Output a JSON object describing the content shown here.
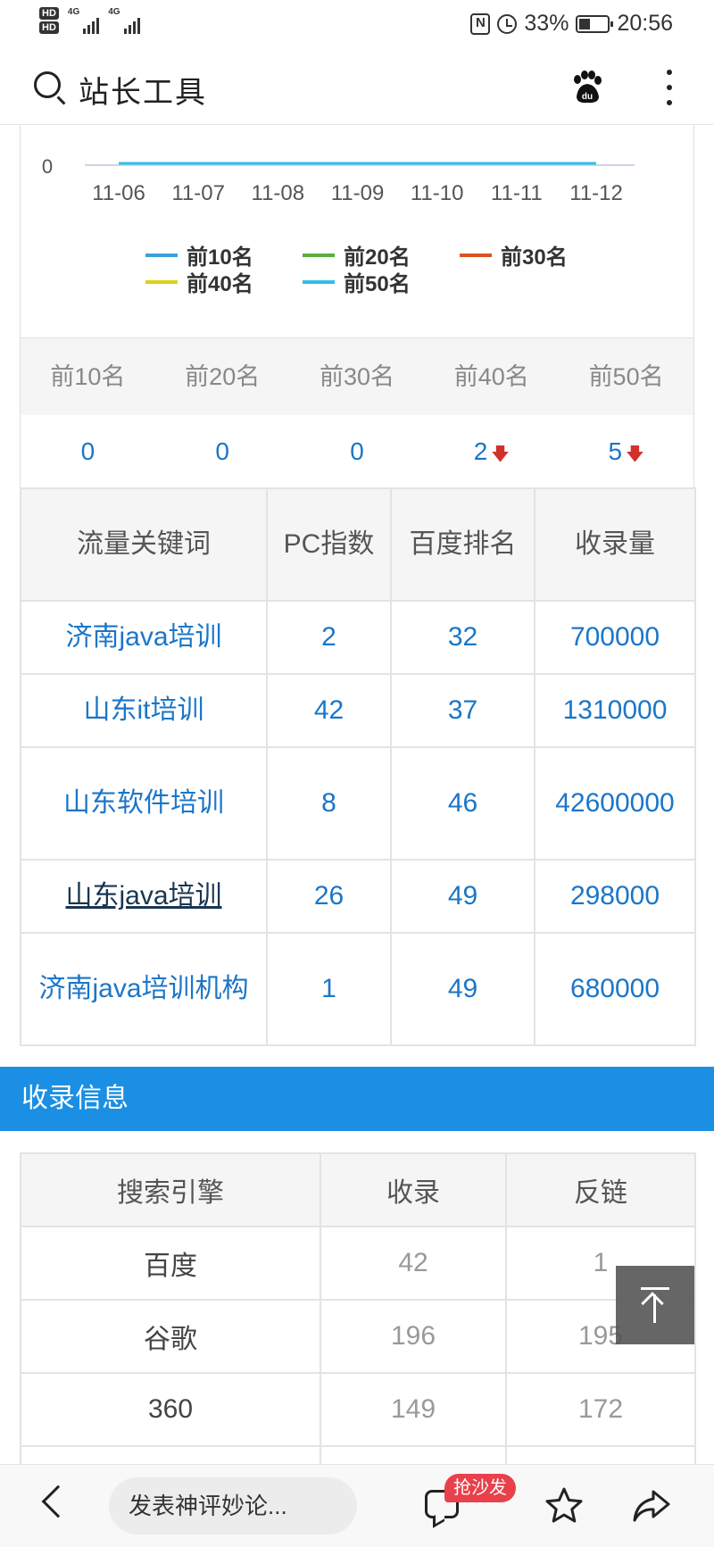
{
  "status_bar": {
    "hd1": "HD",
    "hd2": "HD",
    "net1": "4G",
    "net2": "4G",
    "nfc": "N",
    "battery": "33%",
    "time": "20:56"
  },
  "header": {
    "title": "站长工具",
    "icons": [
      "search-icon",
      "baidu-paw-icon",
      "more-icon"
    ]
  },
  "chart_data": {
    "type": "line",
    "x": [
      "11-06",
      "11-07",
      "11-08",
      "11-09",
      "11-10",
      "11-11",
      "11-12"
    ],
    "ytick": "0",
    "series": [
      {
        "name": "前10名",
        "color": "#3ba0d8",
        "values": [
          0,
          0,
          0,
          0,
          0,
          0,
          0
        ]
      },
      {
        "name": "前20名",
        "color": "#5cab3f",
        "values": [
          0,
          0,
          0,
          0,
          0,
          0,
          0
        ]
      },
      {
        "name": "前30名",
        "color": "#d9541e",
        "values": [
          0,
          0,
          0,
          0,
          0,
          0,
          0
        ]
      },
      {
        "name": "前40名",
        "color": "#e0d012",
        "values": [
          0,
          0,
          0,
          0,
          0,
          0,
          0
        ]
      },
      {
        "name": "前50名",
        "color": "#2fbfe6",
        "values": [
          0,
          0,
          0,
          0,
          0,
          0,
          0
        ]
      }
    ],
    "legend_position": "bottom"
  },
  "rank_summary": {
    "headers": [
      "前10名",
      "前20名",
      "前30名",
      "前40名",
      "前50名"
    ],
    "values": [
      "0",
      "0",
      "0",
      "2",
      "5"
    ],
    "trend": [
      "",
      "",
      "",
      "down",
      "down"
    ],
    "down_arrow": "🡇"
  },
  "keywords_table": {
    "headers": [
      "流量关键词",
      "PC指数",
      "百度排名",
      "收录量"
    ],
    "rows": [
      {
        "keyword": "济南java培训",
        "pc": "2",
        "rank": "32",
        "indexed": "700000"
      },
      {
        "keyword": "山东it培训",
        "pc": "42",
        "rank": "37",
        "indexed": "1310000"
      },
      {
        "keyword": "山东软件培训",
        "pc": "8",
        "rank": "46",
        "indexed": "42600000"
      },
      {
        "keyword": "山东java培训",
        "pc": "26",
        "rank": "49",
        "indexed": "298000"
      },
      {
        "keyword": "济南java培训机构",
        "pc": "1",
        "rank": "49",
        "indexed": "680000"
      }
    ]
  },
  "index_section": {
    "title": "收录信息",
    "headers": [
      "搜索引擎",
      "收录",
      "反链"
    ],
    "rows": [
      {
        "engine": "百度",
        "indexed": "42",
        "backlinks": "1"
      },
      {
        "engine": "谷歌",
        "indexed": "196",
        "backlinks": "195"
      },
      {
        "engine": "360",
        "indexed": "149",
        "backlinks": "172"
      }
    ]
  },
  "bottom_bar": {
    "comment_placeholder": "发表神评妙论...",
    "sofa_badge": "抢沙发"
  }
}
